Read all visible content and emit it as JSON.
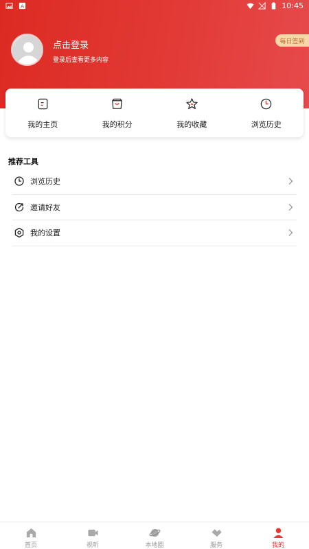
{
  "status_bar": {
    "time": "10:45"
  },
  "profile": {
    "login_title": "点击登录",
    "login_subtitle": "登录后查看更多内容",
    "checkin_label": "每日签到"
  },
  "quick_actions": [
    {
      "label": "我的主页",
      "icon": "homepage-doc-icon"
    },
    {
      "label": "我的积分",
      "icon": "points-bag-icon"
    },
    {
      "label": "我的收藏",
      "icon": "star-icon"
    },
    {
      "label": "浏览历史",
      "icon": "clock-icon"
    }
  ],
  "tools": {
    "title": "推荐工具",
    "items": [
      {
        "label": "浏览历史",
        "icon": "clock-icon"
      },
      {
        "label": "邀请好友",
        "icon": "invite-icon"
      },
      {
        "label": "我的设置",
        "icon": "settings-hexagon-icon"
      }
    ]
  },
  "tabbar": {
    "items": [
      {
        "label": "首页",
        "icon": "home-icon"
      },
      {
        "label": "视听",
        "icon": "video-camera-icon"
      },
      {
        "label": "本地圈",
        "icon": "planet-icon"
      },
      {
        "label": "服务",
        "icon": "handshake-icon"
      },
      {
        "label": "我的",
        "icon": "person-icon",
        "active": true
      }
    ]
  },
  "colors": {
    "brand_red": "#e13a36",
    "checkin_bg": "#f7d7a8",
    "checkin_text": "#b8733b",
    "tab_inactive": "#999999"
  }
}
